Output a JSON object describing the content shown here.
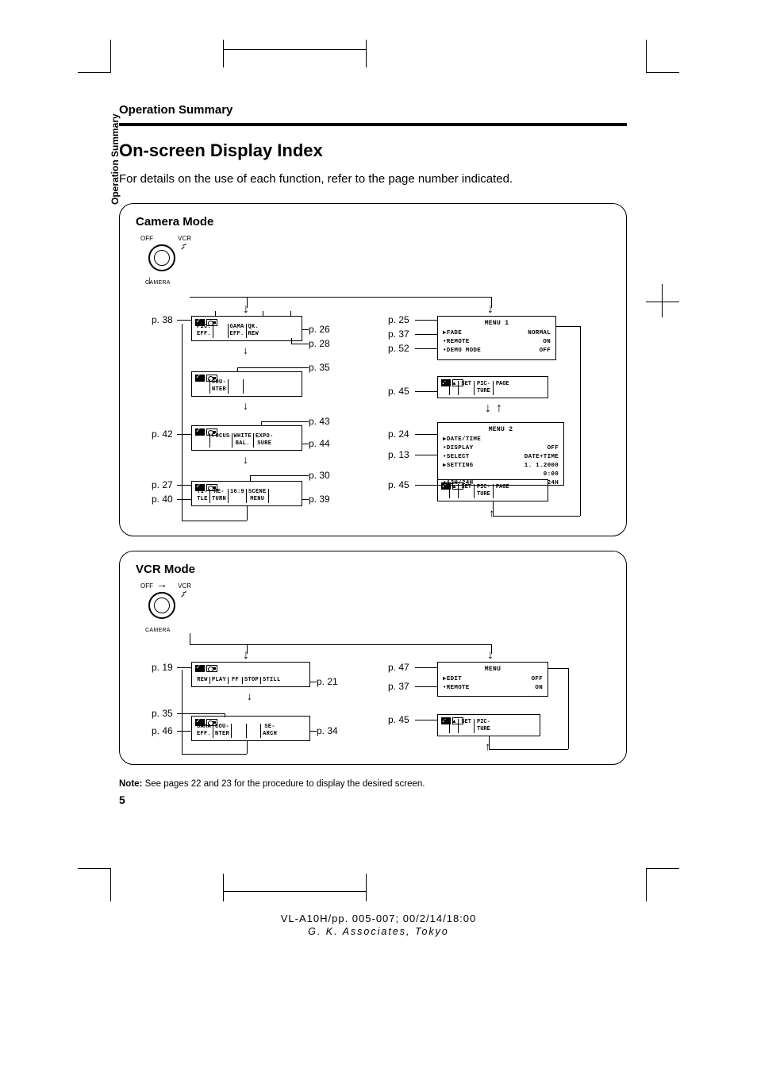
{
  "running_head": "Operation Summary",
  "side_tab": "Operation Summary",
  "heading": "On-screen Display Index",
  "intro": "For details on the use of each function, refer to the page number indicated.",
  "page_number": "5",
  "camera": {
    "title": "Camera Mode",
    "dial": {
      "off": "OFF",
      "vcr": "VCR",
      "camera": "CAMERA"
    },
    "scr1": {
      "seg1": "PIC.\nEFF.",
      "seg2": "",
      "seg3": "GAMA\nEFF.",
      "seg4": "QK.\nREW"
    },
    "scr2": {
      "seg1": "",
      "seg2": "COU-\nNTER",
      "seg3": "",
      "seg4": ""
    },
    "scr3": {
      "seg1": "",
      "seg2": "FOCUS",
      "seg3": "WHITE\nBAL.",
      "seg4": "EXPO-\nSURE"
    },
    "scr4": {
      "seg1": "TI-\nTLE",
      "seg2": "RE-\nTURN",
      "seg3": "16:9",
      "seg4": "SCENE\nMENU"
    },
    "menu1": {
      "title": "MENU 1",
      "rows": [
        {
          "l": "▶FADE",
          "r": "NORMAL"
        },
        {
          "l": "•REMOTE",
          "r": "ON"
        },
        {
          "l": "•DEMO MODE",
          "r": "OFF"
        }
      ]
    },
    "nav1": {
      "seg1": "▼",
      "seg2": "▲",
      "seg3": "SET",
      "seg4": "PIC-\nTURE",
      "seg5": "PAGE"
    },
    "menu2": {
      "title": "MENU 2",
      "rows": [
        {
          "l": "▶DATE/TIME",
          "r": ""
        },
        {
          "l": "•DISPLAY",
          "r": "OFF"
        },
        {
          "l": "•SELECT",
          "r": "DATE+TIME"
        },
        {
          "l": "▶SETTING",
          "r": "1. 1.2000"
        },
        {
          "l": "",
          "r": "0:00"
        },
        {
          "l": "•12H/24H",
          "r": "24H"
        }
      ]
    },
    "nav2": {
      "seg1": "▼",
      "seg2": "▲",
      "seg3": "SET",
      "seg4": "PIC-\nTURE",
      "seg5": "PAGE"
    },
    "refs": {
      "p38": "p. 38",
      "p26": "p. 26",
      "p28": "p. 28",
      "p35": "p. 35",
      "p42": "p. 42",
      "p43": "p. 43",
      "p44": "p. 44",
      "p27": "p. 27",
      "p40": "p. 40",
      "p30": "p. 30",
      "p39": "p. 39",
      "p25": "p. 25",
      "p37": "p. 37",
      "p52": "p. 52",
      "p45a": "p. 45",
      "p24": "p. 24",
      "p13": "p. 13",
      "p45b": "p. 45"
    }
  },
  "vcr": {
    "title": "VCR Mode",
    "dial": {
      "off": "OFF",
      "vcr": "VCR",
      "camera": "CAMERA"
    },
    "scr1": {
      "seg1": "REW",
      "seg2": "PLAY",
      "seg3": "FF",
      "seg4": "STOP",
      "seg5": "STILL"
    },
    "scr2": {
      "seg1": "GAMA\nEFF.",
      "seg2": "COU-\nNTER",
      "seg3": "",
      "seg4": "",
      "seg5": "SE-\nARCH"
    },
    "menu": {
      "title": "MENU",
      "rows": [
        {
          "l": "▶EDIT",
          "r": "OFF"
        },
        {
          "l": "•REMOTE",
          "r": "ON"
        }
      ]
    },
    "nav": {
      "seg1": "▼",
      "seg2": "▲",
      "seg3": "SET",
      "seg4": "PIC-\nTURE"
    },
    "refs": {
      "p19": "p. 19",
      "p21": "p. 21",
      "p35": "p. 35",
      "p46": "p. 46",
      "p34": "p. 34",
      "p47": "p. 47",
      "p37": "p. 37",
      "p45": "p. 45"
    }
  },
  "note_label": "Note:",
  "note_text": " See pages 22 and 23 for the procedure to display the desired screen.",
  "footer_line1": "VL-A10H/pp. 005-007; 00/2/14/18:00",
  "footer_line2": "G. K. Associates, Tokyo"
}
